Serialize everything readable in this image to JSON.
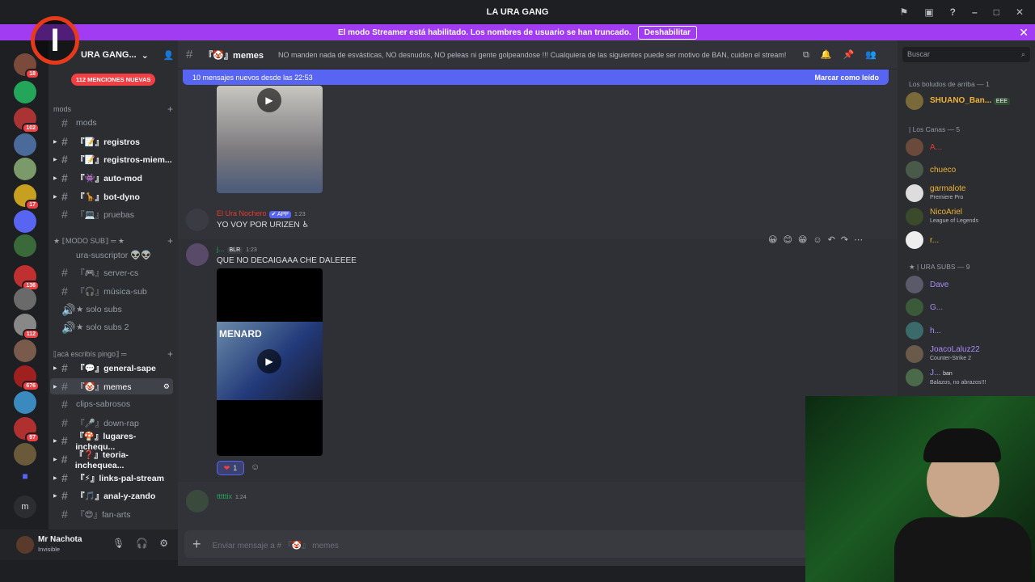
{
  "window": {
    "title": "LA URA GANG"
  },
  "streamer_bar": {
    "text": "El modo Streamer está habilitado. Los nombres de usuario se han truncado.",
    "button": "Deshabilitar"
  },
  "server": {
    "name": "URA GANG...",
    "mentions_pill": "112 MENCIONES NUEVAS"
  },
  "guild_badges": [
    "18",
    "102",
    "17",
    "136",
    "112",
    "676",
    "97"
  ],
  "guild_letter": "m",
  "categories": {
    "mods": "mods",
    "modo_sub": "★ ⟦MODO SUB⟧ ═ ★",
    "aca": "⟦acá escribís pingo⟧ ═"
  },
  "channels": {
    "mods": "mods",
    "registros": "『📝』registros",
    "registros_miem": "『📝』registros-miem...",
    "auto_mod": "『👾』auto-mod",
    "bot_dyno": "『🦒』bot-dyno",
    "pruebas": "『💻』pruebas",
    "ura_suscriptor": "ura-suscriptor 👽👽",
    "server_cs": "『🎮』server-cs",
    "musica_sub": "『🎧』música-sub",
    "solo_subs": "★ solo subs",
    "solo_subs_2": "★ solo subs 2",
    "general_sape": "『💬』general-sape",
    "memes": "『🤡』memes",
    "clips_sabrosos": "clips-sabrosos",
    "down_rap": "『🎤』down-rap",
    "lugares": "『🍄』lugares-inchequ...",
    "teoria": "『❓』teoria-inchequea...",
    "links": "『⚡』links-pal-stream",
    "anal": "『🎵』anal-y-zando",
    "fan_arts": "『😍』fan-arts"
  },
  "user": {
    "name": "Mr Nachota",
    "status": "Invisible"
  },
  "channel_header": {
    "name": "『🤡』memes",
    "topic": "NO manden nada de esvásticas, NO desnudos, NO peleas ni gente golpeandose !!! Cualquiera de las siguientes puede ser motivo de BAN, cuiden el stream!"
  },
  "new_messages": {
    "text": "10 mensajes nuevos desde las 22:53",
    "mark": "Marcar como leído"
  },
  "messages": [
    {
      "author": "El Ura Nochero",
      "tag": "✔ APP",
      "time": "1:23",
      "text": "YO VOY POR URIZEN ♿"
    },
    {
      "author": "j...",
      "tag": "BLR",
      "time": "1:23",
      "text": "QUE NO DECAIGAAA CHE DALEEEE",
      "video_caption": "MENARD"
    },
    {
      "author": "tttttix",
      "time": "1:24",
      "text": ""
    }
  ],
  "reaction": {
    "emoji": "❤",
    "count": "1"
  },
  "composer": {
    "placeholder": "Enviar mensaje a # 『🤡』 memes",
    "search": "Buscar"
  },
  "members": {
    "sections": [
      "Los boludos de arriba — 1",
      "| Los Canas — 5",
      "★ | URA SUBS — 9"
    ],
    "list": [
      {
        "name": "SHUANO_Ban...",
        "sub": "",
        "badge": "EEE",
        "color": "#f0b232"
      },
      {
        "name": "A...",
        "sub": "",
        "color": "#e8392d"
      },
      {
        "name": "chueco",
        "sub": "",
        "color": "#f0b232"
      },
      {
        "name": "garmalote",
        "sub": "Premiere Pro",
        "color": "#f0b232"
      },
      {
        "name": "NicoAriel",
        "sub": "League of Legends",
        "color": "#f0b232"
      },
      {
        "name": "r...",
        "sub": "",
        "color": "#f0b232"
      },
      {
        "name": "Dave",
        "sub": "",
        "color": "#a98cf5"
      },
      {
        "name": "G...",
        "sub": "",
        "color": "#a98cf5"
      },
      {
        "name": "h...",
        "sub": "",
        "color": "#a98cf5"
      },
      {
        "name": "JoacoLaluz22",
        "sub": "Counter-Strike 2",
        "color": "#a98cf5"
      },
      {
        "name": "J...",
        "sub": "Balazos, no abrazos!!!",
        "badge": "ban",
        "color": "#a98cf5"
      }
    ]
  }
}
